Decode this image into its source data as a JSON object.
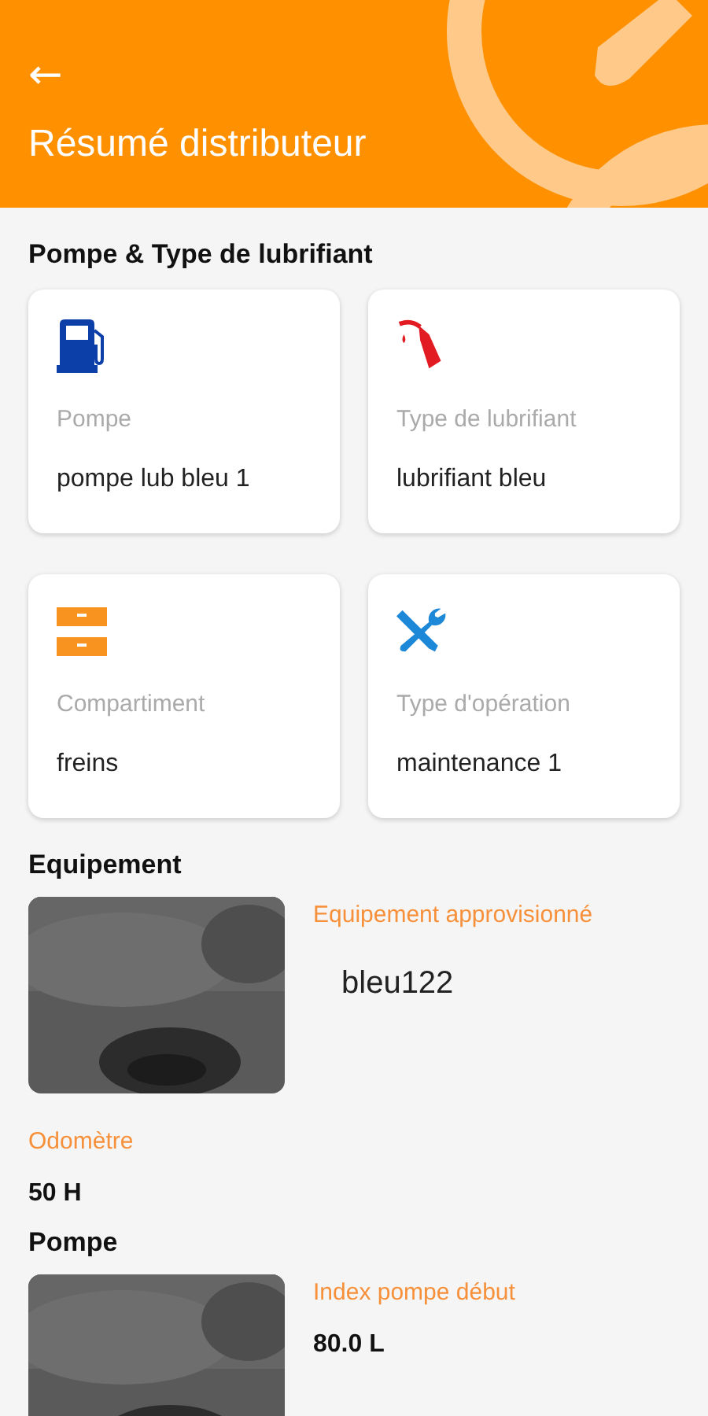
{
  "header": {
    "back_icon": "←",
    "title": "Résumé distributeur"
  },
  "summary": {
    "title": "Pompe & Type de lubrifiant",
    "cards": [
      {
        "kind": "pump",
        "label": "Pompe",
        "value": "pompe lub bleu 1"
      },
      {
        "kind": "nozzle",
        "label": "Type de lubrifiant",
        "value": "lubrifiant bleu"
      },
      {
        "kind": "drawers",
        "label": "Compartiment",
        "value": "freins"
      },
      {
        "kind": "tools",
        "label": "Type d'opération",
        "value": "maintenance 1"
      }
    ]
  },
  "equipment": {
    "title": "Equipement",
    "field_label": "Equipement approvisionné",
    "field_value": "bleu122",
    "odometer_label": "Odomètre",
    "odometer_value": "50 H"
  },
  "pump": {
    "title": "Pompe",
    "field_label": "Index pompe début",
    "field_value": "80.0 L"
  }
}
